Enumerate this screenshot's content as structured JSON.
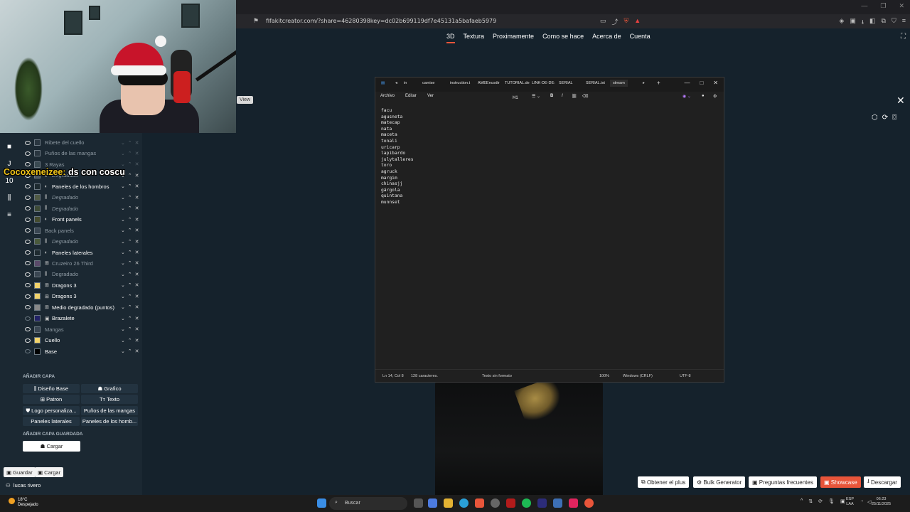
{
  "browser": {
    "url": "fifakitcreator.com/?share=46280398key=dc02b699119df7e45131a5bafaeb5979"
  },
  "site_nav": [
    "3D",
    "Textura",
    "Proximamente",
    "Como se hace",
    "Acerca de",
    "Cuenta"
  ],
  "webcam": {
    "view_label": "View"
  },
  "chat": {
    "user": "Cocoxeneizee:",
    "message": "ds con coscu"
  },
  "layers": [
    {
      "name": "Ribete del cuello",
      "visible": true,
      "style": "dim"
    },
    {
      "name": "Puños de las mangas",
      "visible": true,
      "style": "dim"
    },
    {
      "name": "3 Rayas",
      "visible": true,
      "style": "dim"
    },
    {
      "name": "Degradado",
      "visible": true,
      "style": "ital"
    },
    {
      "name": "Paneles de los hombros",
      "visible": true,
      "style": "strong"
    },
    {
      "name": "Degradado",
      "visible": true,
      "style": "ital"
    },
    {
      "name": "Degradado",
      "visible": true,
      "style": "ital"
    },
    {
      "name": "Front panels",
      "visible": true,
      "style": "strong"
    },
    {
      "name": "Back panels",
      "visible": true,
      "style": "dim"
    },
    {
      "name": "Degradado",
      "visible": true,
      "style": "ital"
    },
    {
      "name": "Paneles laterales",
      "visible": true,
      "style": "strong"
    },
    {
      "name": "Cruzeiro 26 Third",
      "visible": true,
      "style": "dim"
    },
    {
      "name": "Degradado",
      "visible": true,
      "style": "dim"
    },
    {
      "name": "Dragons 3",
      "visible": true,
      "style": "strong"
    },
    {
      "name": "Dragons 3",
      "visible": true,
      "style": "strong"
    },
    {
      "name": "Medio degradado (puntos)",
      "visible": true,
      "style": "strong"
    },
    {
      "name": "Brazalete",
      "visible": false,
      "style": "strong"
    },
    {
      "name": "Mangas",
      "visible": true,
      "style": "dim"
    },
    {
      "name": "Cuello",
      "visible": true,
      "style": "strong"
    },
    {
      "name": "Base",
      "visible": false,
      "style": "strong"
    }
  ],
  "add_layer": {
    "title": "AÑADIR CAPA",
    "buttons": [
      "Diseño Base",
      "Grafico",
      "Patron",
      "Texto",
      "Logo personaliza...",
      "Puños de las mangas",
      "Paneles laterales",
      "Paneles de los homb..."
    ]
  },
  "saved_layer": {
    "title": "AÑADIR CAPA GUARDADA",
    "load": "Cargar"
  },
  "footer": {
    "save": "Guardar",
    "load": "Cargar",
    "user": "lucas rivero"
  },
  "tool_number": "10",
  "notepad": {
    "tabs": [
      "in",
      "camise",
      "instruction.t",
      "AMEEncodir",
      "TUTORIAL.de",
      "LINK-DE-DE:",
      "SERIAL",
      "SERIAL.txt",
      "stream"
    ],
    "menu": [
      "Archivo",
      "Editar",
      "Ver"
    ],
    "heading_sel": "H1",
    "lines": [
      "facu",
      "agusneta",
      "matecap",
      "nata",
      "maceta",
      "tonali",
      "uricarp",
      "lapibardo",
      "julytalleres",
      "toro",
      "agruck",
      "margim",
      "chinasjj",
      "gárgola",
      "quintana",
      "munnset"
    ],
    "status": {
      "position": "Ln 14, Col 8",
      "chars": "128 caracteres.",
      "format": "Texto sin formato",
      "zoom": "100%",
      "eol": "Windows (CRLF)",
      "encoding": "UTF-8"
    }
  },
  "bottom_buttons": [
    "Obtener el plus",
    "Bulk Generator",
    "Preguntas frecuentes",
    "Showcase",
    "Descargar"
  ],
  "taskbar": {
    "temp": "18°C",
    "weather": "Despejado",
    "search": "Buscar",
    "lang1": "ESP",
    "lang2": "LAA",
    "time": "06:23",
    "date": "25/11/2025"
  },
  "colors": {
    "accent": "#e8553a",
    "bg": "#15222c",
    "panel": "#1b2832"
  }
}
